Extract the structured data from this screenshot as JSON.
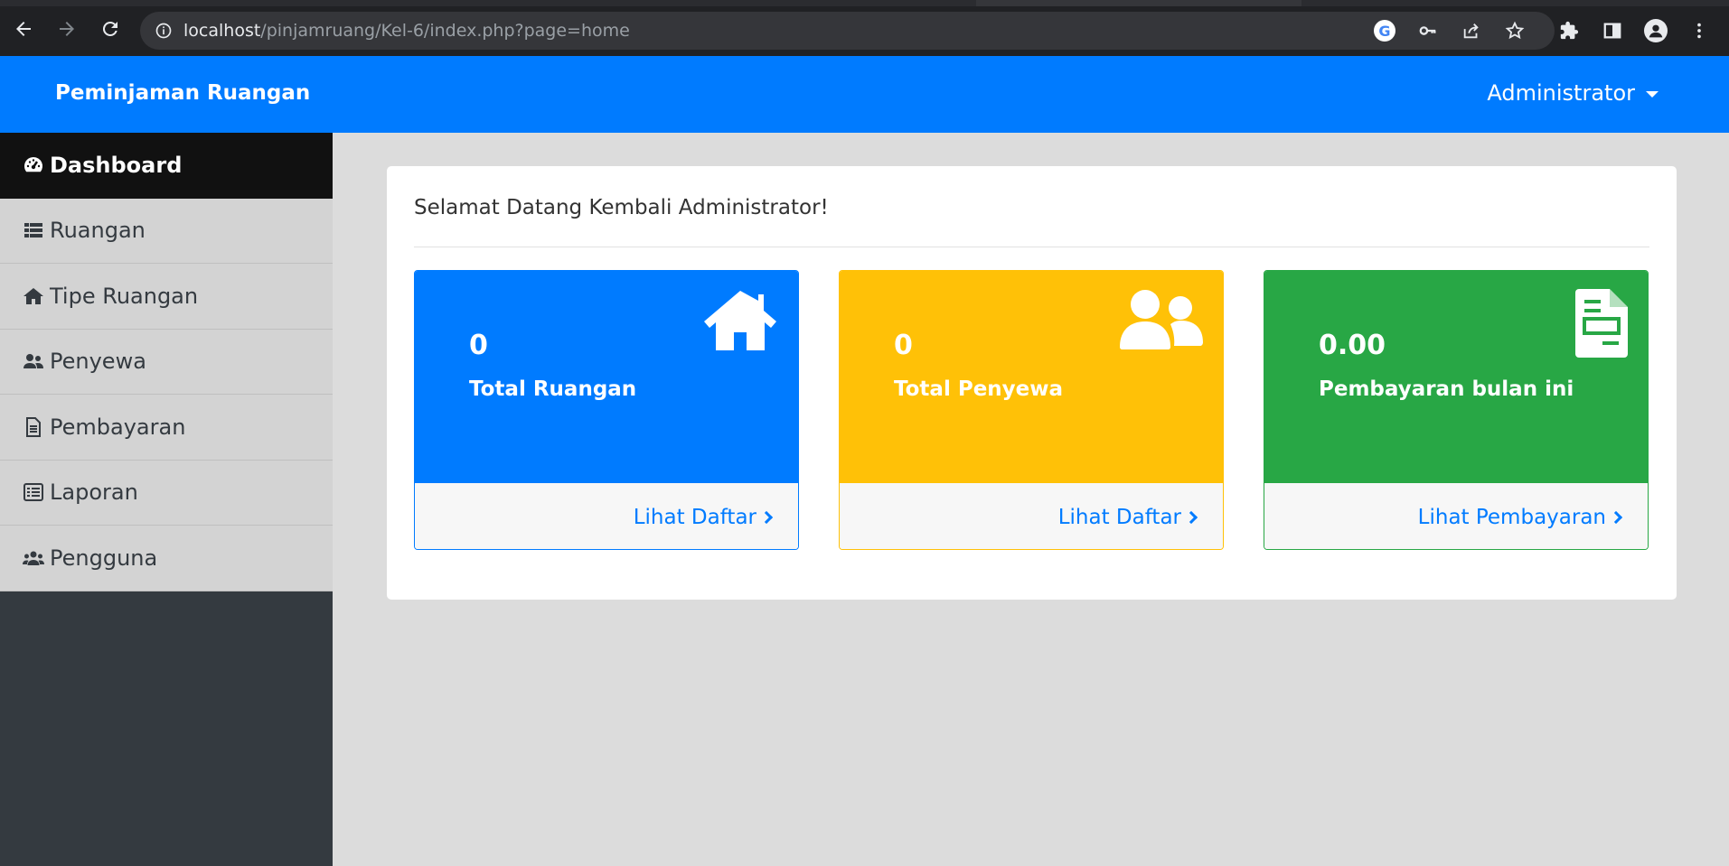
{
  "browser": {
    "url_host": "localhost",
    "url_path": "/pinjamruang/Kel-6/index.php?page=home",
    "icons": [
      "back-icon",
      "forward-icon",
      "reload-icon",
      "info-icon",
      "google-icon",
      "key-icon",
      "share-icon",
      "star-icon",
      "extensions-icon",
      "side-panel-icon",
      "profile-icon",
      "menu-icon"
    ]
  },
  "navbar": {
    "brand": "Peminjaman Ruangan",
    "user": "Administrator"
  },
  "sidebar": {
    "items": [
      {
        "label": "Dashboard",
        "icon": "gauge-icon",
        "active": true
      },
      {
        "label": "Ruangan",
        "icon": "list-icon"
      },
      {
        "label": "Tipe Ruangan",
        "icon": "home-icon"
      },
      {
        "label": "Penyewa",
        "icon": "users-icon"
      },
      {
        "label": "Pembayaran",
        "icon": "file-icon"
      },
      {
        "label": "Laporan",
        "icon": "list-alt-icon"
      },
      {
        "label": "Pengguna",
        "icon": "users-group-icon"
      }
    ]
  },
  "main": {
    "welcome": "Selamat Datang Kembali Administrator!",
    "stats": [
      {
        "value": "0",
        "label": "Total Ruangan",
        "link": "Lihat Daftar",
        "icon": "house-icon",
        "color": "#007bff"
      },
      {
        "value": "0",
        "label": "Total Penyewa",
        "link": "Lihat Daftar",
        "icon": "user-friends-icon",
        "color": "#ffc107"
      },
      {
        "value": "0.00",
        "label": "Pembayaran bulan ini",
        "link": "Lihat Pembayaran",
        "icon": "invoice-icon",
        "color": "#28a745"
      }
    ]
  }
}
